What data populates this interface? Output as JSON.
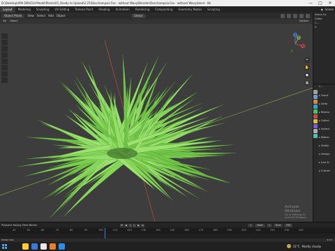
{
  "window": {
    "title": "D:\\Desktop\\APA-DRAZ3d-Model\\Plants\\01_Ready to Upload\\2.25\\Deschampsia Fax - without Wavy\\Blender\\Deschampsia Fax - without Wavy.blend - Blender 4.0",
    "min": "—",
    "max": "□",
    "close": "✕"
  },
  "menubar": {
    "tabs": [
      "Layout",
      "Modeling",
      "Sculpting",
      "UV Editing",
      "Texture Paint",
      "Shading",
      "Animation",
      "Rendering",
      "Compositing",
      "Geometry Nodes",
      "Scripting"
    ],
    "active_tab": "Layout",
    "scene_label": "Scene"
  },
  "viewport": {
    "mode_label": "Object Mode",
    "menu_items": [
      "View",
      "Select",
      "Add",
      "Object"
    ],
    "global_label": "Global",
    "options_label": "Options",
    "sub_left": "Sel",
    "sub_left2": "Object",
    "gizmo": {
      "x": "X",
      "y": "Y",
      "z": "Z"
    }
  },
  "outliner": {
    "rows": [
      "Scene Co",
      "Collec",
      "C...",
      "V"
    ]
  },
  "properties": {
    "header": "C...",
    "rows": [
      "Transf",
      "Delta",
      "Relatio",
      "Collect",
      "Instanc",
      "Motion",
      "Visibili",
      "Viewpo",
      "Line Ar",
      "Custom"
    ],
    "tab_colors": [
      "#a3a3a3",
      "#6a9bd4",
      "#d48a3a",
      "#3aa0d4",
      "#4cc35a",
      "#c34c4c",
      "#d4c03a",
      "#7a5cd4",
      "#b0b0b0",
      "#4cc3b0"
    ]
  },
  "timeline": {
    "playback_label": "Playback",
    "keying_label": "Keying",
    "view_label": "View",
    "marker_label": "Marker",
    "current_frame": "1",
    "start_label": "Start",
    "start_value": "1",
    "end_label": "End",
    "end_value": "250",
    "ruler": [
      "40",
      "50",
      "60",
      "70",
      "80",
      "90",
      "100",
      "110",
      "120",
      "130",
      "140",
      "150",
      "160",
      "170",
      "180",
      "190",
      "200",
      "210",
      "220",
      "230",
      "240"
    ]
  },
  "statusbar": {
    "left": "Rotate View",
    "right": "4.0.2"
  },
  "watermark": {
    "title": "Activate Windows",
    "sub": "Go to Settings to activate Windows."
  },
  "taskbar": {
    "weather_temp": "31°C",
    "weather_text": "Mostly cloudy",
    "icon_colors": [
      "#ffcc33",
      "#3a7bd5",
      "#e8e8e8",
      "#e87d2a",
      "#2a8ee8"
    ]
  },
  "colors": {
    "viewport_bg": "#3d3d3d",
    "grass": "#86d65a",
    "x_axis": "#c04848",
    "y_axis": "#84a04a",
    "accent": "#4b7bd4"
  }
}
